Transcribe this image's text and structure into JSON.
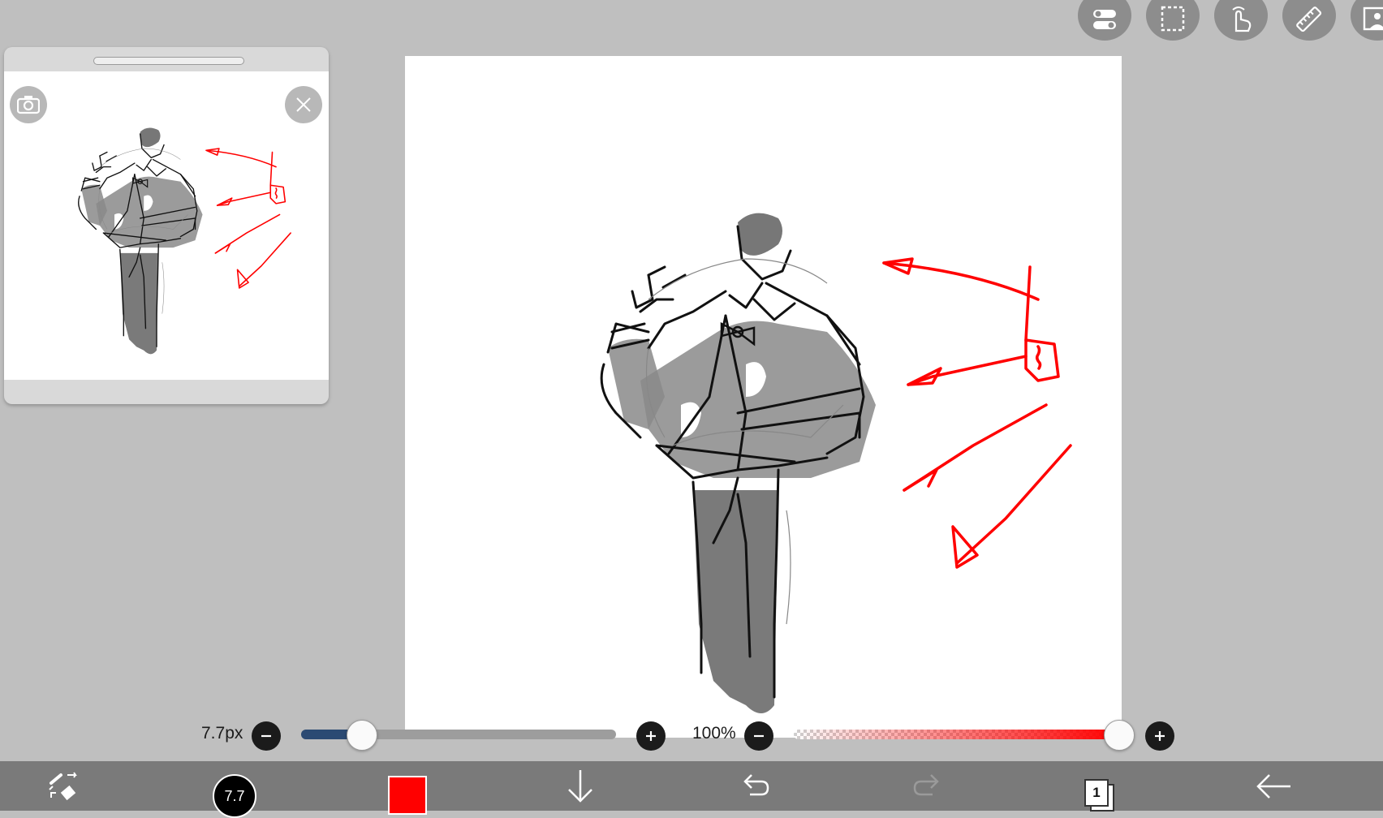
{
  "toolbar_top": {
    "buttons": [
      {
        "name": "toggle-settings-icon"
      },
      {
        "name": "selection-icon"
      },
      {
        "name": "hand-icon"
      },
      {
        "name": "ruler-icon"
      },
      {
        "name": "image-icon"
      }
    ]
  },
  "reference_window": {
    "buttons": [
      "camera-icon",
      "close-icon"
    ]
  },
  "brush": {
    "size_label": "7.7px",
    "size_fraction": 0.19,
    "circle_label": "7.7"
  },
  "opacity": {
    "label": "100%",
    "value_percent": 100
  },
  "colors": {
    "current": "#ff0000",
    "size_slider_fill": "#2b4a73",
    "bottom_bar": "#7a7a7a",
    "background": "#bfbfbf"
  },
  "layers": {
    "count_label": "1"
  },
  "bottom_bar": {
    "items": [
      "brush-eraser-switch-icon",
      "brush-size",
      "color",
      "download-icon",
      "undo-icon",
      "redo-icon",
      "layers-icon",
      "back-icon"
    ]
  }
}
